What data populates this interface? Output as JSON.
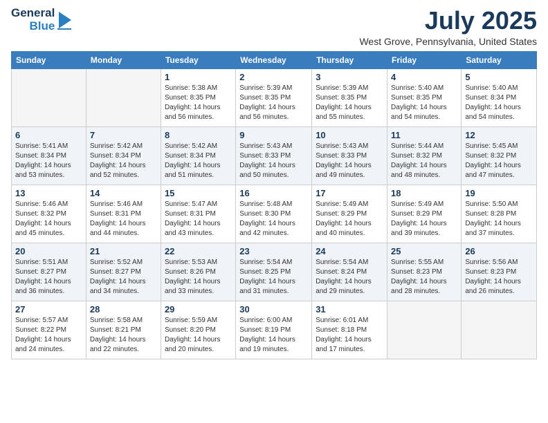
{
  "header": {
    "logo": {
      "line1": "General",
      "line2": "Blue"
    },
    "title": "July 2025",
    "subtitle": "West Grove, Pennsylvania, United States"
  },
  "weekdays": [
    "Sunday",
    "Monday",
    "Tuesday",
    "Wednesday",
    "Thursday",
    "Friday",
    "Saturday"
  ],
  "weeks": [
    [
      {
        "day": "",
        "info": ""
      },
      {
        "day": "",
        "info": ""
      },
      {
        "day": "1",
        "info": "Sunrise: 5:38 AM\nSunset: 8:35 PM\nDaylight: 14 hours and 56 minutes."
      },
      {
        "day": "2",
        "info": "Sunrise: 5:39 AM\nSunset: 8:35 PM\nDaylight: 14 hours and 56 minutes."
      },
      {
        "day": "3",
        "info": "Sunrise: 5:39 AM\nSunset: 8:35 PM\nDaylight: 14 hours and 55 minutes."
      },
      {
        "day": "4",
        "info": "Sunrise: 5:40 AM\nSunset: 8:35 PM\nDaylight: 14 hours and 54 minutes."
      },
      {
        "day": "5",
        "info": "Sunrise: 5:40 AM\nSunset: 8:34 PM\nDaylight: 14 hours and 54 minutes."
      }
    ],
    [
      {
        "day": "6",
        "info": "Sunrise: 5:41 AM\nSunset: 8:34 PM\nDaylight: 14 hours and 53 minutes."
      },
      {
        "day": "7",
        "info": "Sunrise: 5:42 AM\nSunset: 8:34 PM\nDaylight: 14 hours and 52 minutes."
      },
      {
        "day": "8",
        "info": "Sunrise: 5:42 AM\nSunset: 8:34 PM\nDaylight: 14 hours and 51 minutes."
      },
      {
        "day": "9",
        "info": "Sunrise: 5:43 AM\nSunset: 8:33 PM\nDaylight: 14 hours and 50 minutes."
      },
      {
        "day": "10",
        "info": "Sunrise: 5:43 AM\nSunset: 8:33 PM\nDaylight: 14 hours and 49 minutes."
      },
      {
        "day": "11",
        "info": "Sunrise: 5:44 AM\nSunset: 8:32 PM\nDaylight: 14 hours and 48 minutes."
      },
      {
        "day": "12",
        "info": "Sunrise: 5:45 AM\nSunset: 8:32 PM\nDaylight: 14 hours and 47 minutes."
      }
    ],
    [
      {
        "day": "13",
        "info": "Sunrise: 5:46 AM\nSunset: 8:32 PM\nDaylight: 14 hours and 45 minutes."
      },
      {
        "day": "14",
        "info": "Sunrise: 5:46 AM\nSunset: 8:31 PM\nDaylight: 14 hours and 44 minutes."
      },
      {
        "day": "15",
        "info": "Sunrise: 5:47 AM\nSunset: 8:31 PM\nDaylight: 14 hours and 43 minutes."
      },
      {
        "day": "16",
        "info": "Sunrise: 5:48 AM\nSunset: 8:30 PM\nDaylight: 14 hours and 42 minutes."
      },
      {
        "day": "17",
        "info": "Sunrise: 5:49 AM\nSunset: 8:29 PM\nDaylight: 14 hours and 40 minutes."
      },
      {
        "day": "18",
        "info": "Sunrise: 5:49 AM\nSunset: 8:29 PM\nDaylight: 14 hours and 39 minutes."
      },
      {
        "day": "19",
        "info": "Sunrise: 5:50 AM\nSunset: 8:28 PM\nDaylight: 14 hours and 37 minutes."
      }
    ],
    [
      {
        "day": "20",
        "info": "Sunrise: 5:51 AM\nSunset: 8:27 PM\nDaylight: 14 hours and 36 minutes."
      },
      {
        "day": "21",
        "info": "Sunrise: 5:52 AM\nSunset: 8:27 PM\nDaylight: 14 hours and 34 minutes."
      },
      {
        "day": "22",
        "info": "Sunrise: 5:53 AM\nSunset: 8:26 PM\nDaylight: 14 hours and 33 minutes."
      },
      {
        "day": "23",
        "info": "Sunrise: 5:54 AM\nSunset: 8:25 PM\nDaylight: 14 hours and 31 minutes."
      },
      {
        "day": "24",
        "info": "Sunrise: 5:54 AM\nSunset: 8:24 PM\nDaylight: 14 hours and 29 minutes."
      },
      {
        "day": "25",
        "info": "Sunrise: 5:55 AM\nSunset: 8:23 PM\nDaylight: 14 hours and 28 minutes."
      },
      {
        "day": "26",
        "info": "Sunrise: 5:56 AM\nSunset: 8:23 PM\nDaylight: 14 hours and 26 minutes."
      }
    ],
    [
      {
        "day": "27",
        "info": "Sunrise: 5:57 AM\nSunset: 8:22 PM\nDaylight: 14 hours and 24 minutes."
      },
      {
        "day": "28",
        "info": "Sunrise: 5:58 AM\nSunset: 8:21 PM\nDaylight: 14 hours and 22 minutes."
      },
      {
        "day": "29",
        "info": "Sunrise: 5:59 AM\nSunset: 8:20 PM\nDaylight: 14 hours and 20 minutes."
      },
      {
        "day": "30",
        "info": "Sunrise: 6:00 AM\nSunset: 8:19 PM\nDaylight: 14 hours and 19 minutes."
      },
      {
        "day": "31",
        "info": "Sunrise: 6:01 AM\nSunset: 8:18 PM\nDaylight: 14 hours and 17 minutes."
      },
      {
        "day": "",
        "info": ""
      },
      {
        "day": "",
        "info": ""
      }
    ]
  ]
}
